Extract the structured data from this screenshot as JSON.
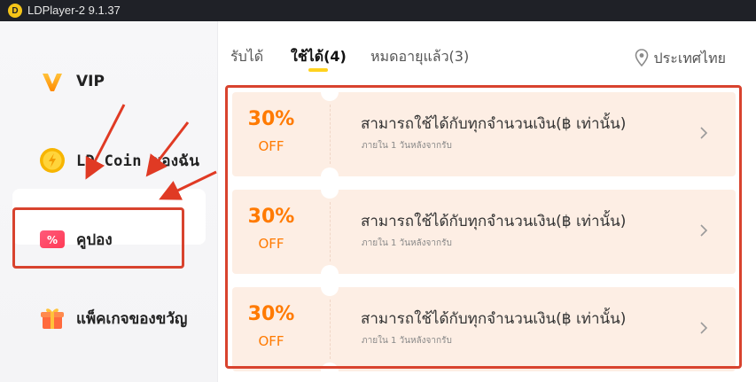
{
  "window": {
    "title": "LDPlayer-2 9.1.37",
    "logo_text": "D"
  },
  "sidebar": {
    "items": [
      {
        "label": "VIP",
        "icon": "vip-icon"
      },
      {
        "label": "LD Coin ของฉัน",
        "icon": "ld-coin-icon"
      },
      {
        "label": "คูปอง",
        "icon": "coupon-icon"
      },
      {
        "label": "แพ็คเกจของขวัญ",
        "icon": "gift-icon"
      }
    ],
    "active_index": 2
  },
  "tabs": {
    "items": [
      {
        "label": "รับได้"
      },
      {
        "label": "ใช้ได้(4)"
      },
      {
        "label": "หมดอายุแล้ว(3)"
      }
    ],
    "active_index": 1
  },
  "region": {
    "label": "ประเทศไทย",
    "icon": "location-pin-icon"
  },
  "coupons": [
    {
      "percent": "30%",
      "off": "OFF",
      "title": "สามารถใช้ได้กับทุกจำนวนเงิน(฿ เท่านั้น)",
      "subtitle": "ภายใน 1 วันหลังจากรับ"
    },
    {
      "percent": "30%",
      "off": "OFF",
      "title": "สามารถใช้ได้กับทุกจำนวนเงิน(฿ เท่านั้น)",
      "subtitle": "ภายใน 1 วันหลังจากรับ"
    },
    {
      "percent": "30%",
      "off": "OFF",
      "title": "สามารถใช้ได้กับทุกจำนวนเงิน(฿ เท่านั้น)",
      "subtitle": "ภายใน 1 วันหลังจากรับ"
    }
  ],
  "colors": {
    "accent_orange": "#ff7a00",
    "coupon_bg": "#fdeee4",
    "tab_underline": "#ffd21e",
    "highlight_red": "#d8432e"
  }
}
